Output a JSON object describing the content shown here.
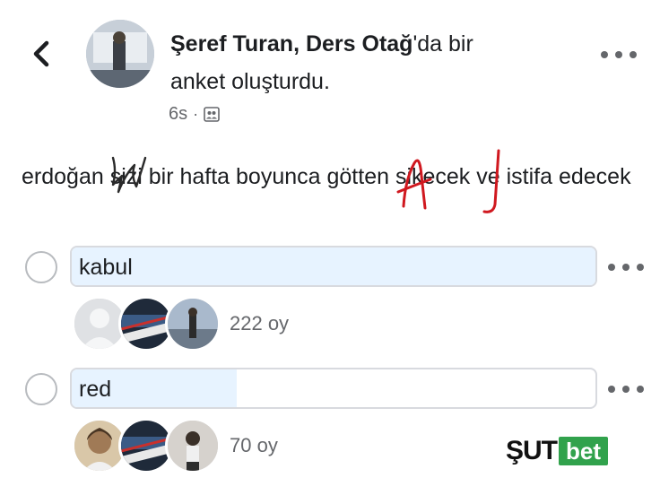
{
  "header": {
    "author": "Şeref Turan, Ders Otağ",
    "action_suffix": "'da bir",
    "action_line2": "anket oluşturdu.",
    "time": "6s",
    "separator": "·",
    "privacy_icon": "friends-icon"
  },
  "post": {
    "text": "erdoğan sizi bir hafta boyunca götten sikecek ve istifa edecek"
  },
  "poll": {
    "options": [
      {
        "label": "kabul",
        "votes": "222 oy",
        "share": 1.0
      },
      {
        "label": "red",
        "votes": "70 oy",
        "share": 0.315
      }
    ]
  },
  "watermark": {
    "part1": "ŞUT",
    "part2": "bet"
  },
  "colors": {
    "poll_fill": "#e7f3ff",
    "secondary_text": "#65676b",
    "watermark_green": "#31a24c",
    "scribble_red": "#d0181f"
  }
}
